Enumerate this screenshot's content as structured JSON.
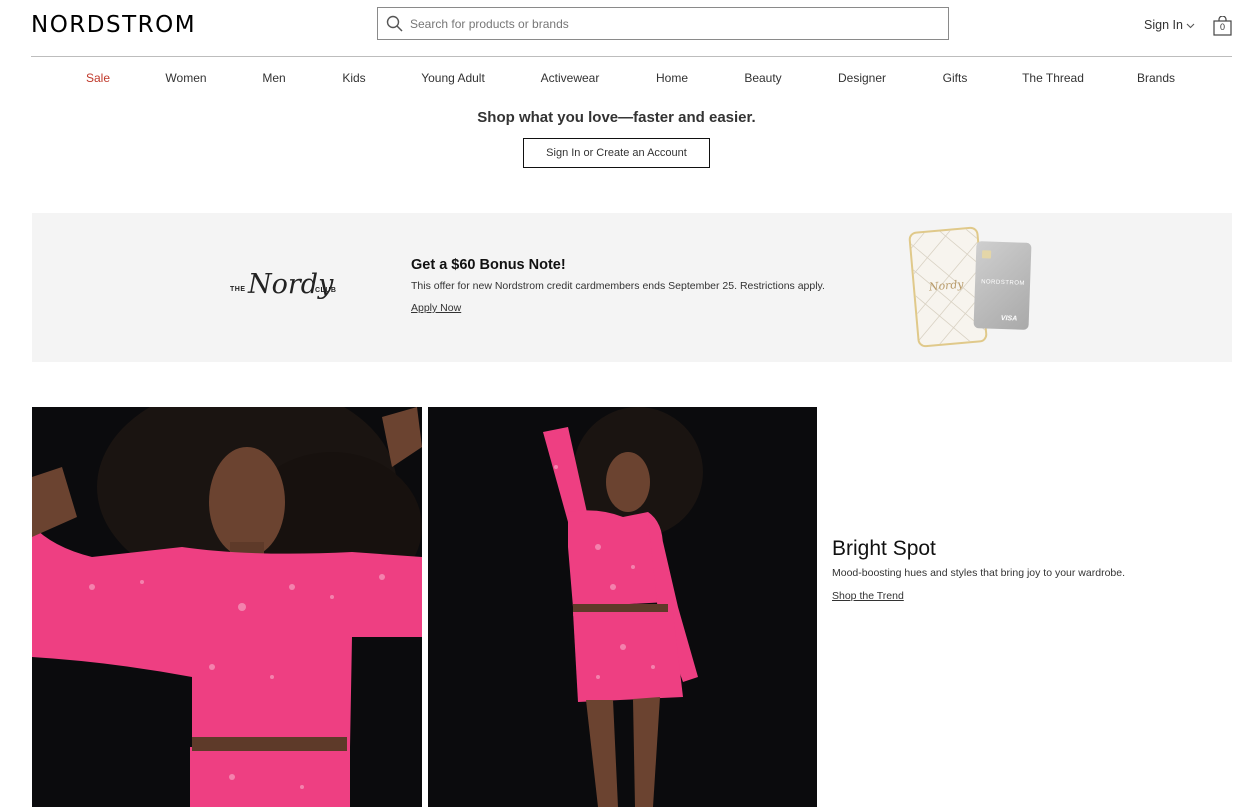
{
  "header": {
    "logo": "NORDSTROM",
    "search_placeholder": "Search for products or brands",
    "signin_label": "Sign In",
    "bag_count": "0"
  },
  "nav": {
    "items": [
      {
        "label": "Sale"
      },
      {
        "label": "Women"
      },
      {
        "label": "Men"
      },
      {
        "label": "Kids"
      },
      {
        "label": "Young Adult"
      },
      {
        "label": "Activewear"
      },
      {
        "label": "Home"
      },
      {
        "label": "Beauty"
      },
      {
        "label": "Designer"
      },
      {
        "label": "Gifts"
      },
      {
        "label": "The Thread"
      },
      {
        "label": "Brands"
      }
    ]
  },
  "signin_promo": {
    "heading": "Shop what you love—faster and easier.",
    "button_label": "Sign In or Create an Account"
  },
  "nordy_banner": {
    "logo_the": "THE",
    "logo_script": "Nordy",
    "logo_club": "CLUB",
    "title": "Get a $60 Bonus Note!",
    "description": "This offer for new Nordstrom credit cardmembers ends September 25. Restrictions apply.",
    "link": "Apply Now",
    "card_brand": "NORDSTROM",
    "card_network": "VISA"
  },
  "feature": {
    "title": "Bright Spot",
    "description": "Mood-boosting hues and styles that bring joy to your wardrobe.",
    "link": "Shop the Trend"
  },
  "colors": {
    "sale_red": "#c0392b",
    "banner_bg": "#f4f4f4",
    "sequin_pink": "#ee3f82"
  }
}
